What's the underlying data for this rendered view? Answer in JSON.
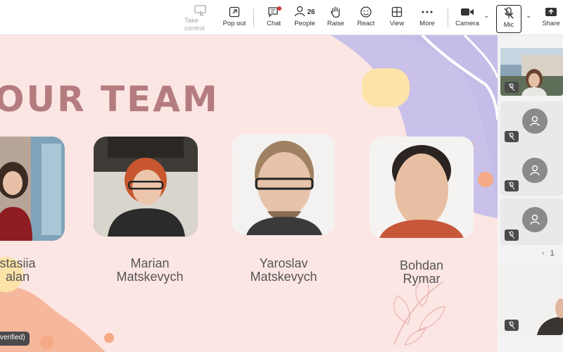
{
  "toolbar": {
    "items": [
      {
        "label": "Take control",
        "icon": "take-control-icon"
      },
      {
        "label": "Pop out",
        "icon": "pop-out-icon"
      },
      {
        "label": "Chat",
        "icon": "chat-icon"
      },
      {
        "label": "People",
        "icon": "people-icon",
        "count": "26"
      },
      {
        "label": "Raise",
        "icon": "raise-hand-icon"
      },
      {
        "label": "React",
        "icon": "react-icon"
      },
      {
        "label": "View",
        "icon": "view-icon"
      },
      {
        "label": "More",
        "icon": "more-icon"
      },
      {
        "label": "Camera",
        "icon": "camera-icon"
      },
      {
        "label": "Mic",
        "icon": "mic-off-icon"
      },
      {
        "label": "Share",
        "icon": "share-icon"
      }
    ]
  },
  "slide": {
    "title": "OUR TEAM",
    "members": [
      {
        "first": "stasiia",
        "last": "alan"
      },
      {
        "first": "Marian",
        "last": "Matskevych"
      },
      {
        "first": "Yaroslav",
        "last": "Matskevych"
      },
      {
        "first": "Bohdan",
        "last": "Rymar"
      }
    ],
    "verified_tag": "verified)"
  },
  "sidebar": {
    "pager_label": "1"
  },
  "colors": {
    "slide_bg": "#fce6e3",
    "title": "#b57c80",
    "lavender": "#c9c1ea",
    "peach": "#f6a986",
    "yellow": "#fde3a7"
  }
}
